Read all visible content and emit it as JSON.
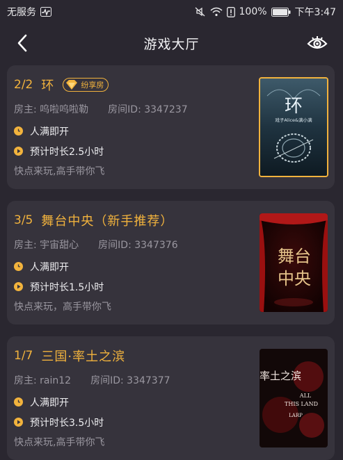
{
  "status": {
    "carrier": "无服务",
    "battery": "100%",
    "time": "下午3:47"
  },
  "header": {
    "title": "游戏大厅"
  },
  "rooms": [
    {
      "count": "2/2",
      "name": "环",
      "badge": "纷享房",
      "host": "房主: 呜啦呜啦勒",
      "room_id": "房间ID: 3347237",
      "start": "人满即开",
      "duration": "预计时长2.5小时",
      "desc": "快点来玩,高手带你飞",
      "poster": {
        "title": "环",
        "subtitle": "戏子Alice&满小满"
      }
    },
    {
      "count": "3/5",
      "name": "舞台中央（新手推荐）",
      "host": "房主: 宇宙甜心",
      "room_id": "房间ID: 3347376",
      "start": "人满即开",
      "duration": "预计时长1.5小时",
      "desc": "快点来玩，高手带你飞",
      "poster": {
        "title_a": "舞台",
        "title_b": "中央"
      }
    },
    {
      "count": "1/7",
      "name": "三国·率土之滨",
      "host": "房主: rain12",
      "room_id": "房间ID: 3347377",
      "start": "人满即开",
      "duration": "预计时长3.5小时",
      "desc": "快点来玩,高手带你飞",
      "poster": {
        "title": "率土之滨",
        "en_a": "ALL",
        "en_b": "THIS LAND",
        "en_c": "LARP"
      }
    }
  ],
  "colors": {
    "accent": "#f2b33d",
    "background": "#2a2730",
    "card": "#36333c",
    "muted_text": "#9a97a0"
  }
}
